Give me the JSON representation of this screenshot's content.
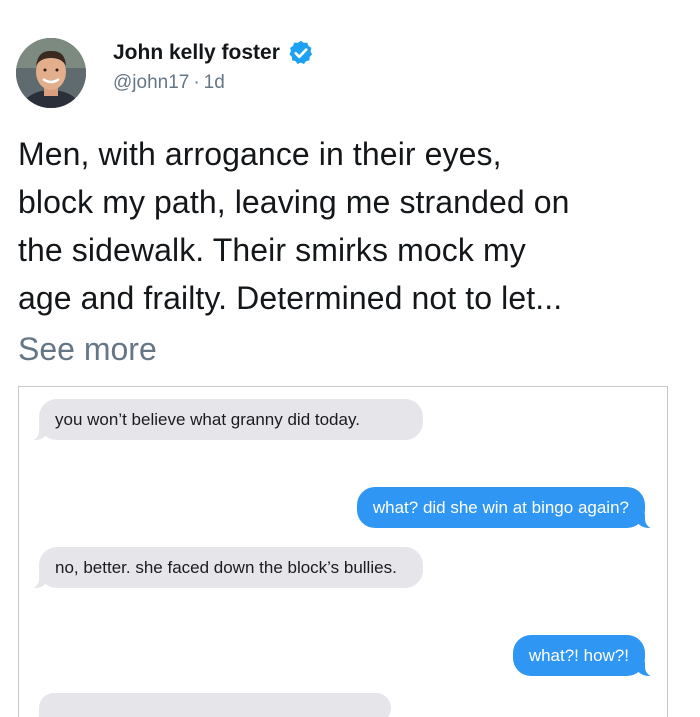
{
  "author": {
    "name": "John kelly foster",
    "handle": "@john17",
    "separator": "·",
    "time": "1d",
    "verified_icon": "verified-badge-icon"
  },
  "tweet": {
    "lines": [
      "Men, with arrogance in their eyes,",
      "block my path, leaving me stranded on",
      "the sidewalk. Their smirks mock my",
      "age and frailty. Determined not to let..."
    ],
    "see_more": "See more"
  },
  "messages": [
    {
      "direction": "incoming",
      "text": "you won’t believe what granny did today."
    },
    {
      "direction": "outgoing",
      "text": "what? did she win at bingo again?"
    },
    {
      "direction": "incoming",
      "text": "no, better. she faced down the block’s bullies."
    },
    {
      "direction": "outgoing",
      "text": "what?! how?!"
    }
  ],
  "colors": {
    "verified_blue": "#1da1f2",
    "outgoing_bubble": "#2f96f4",
    "incoming_bubble": "#e5e5ea",
    "secondary_text": "#657786"
  }
}
